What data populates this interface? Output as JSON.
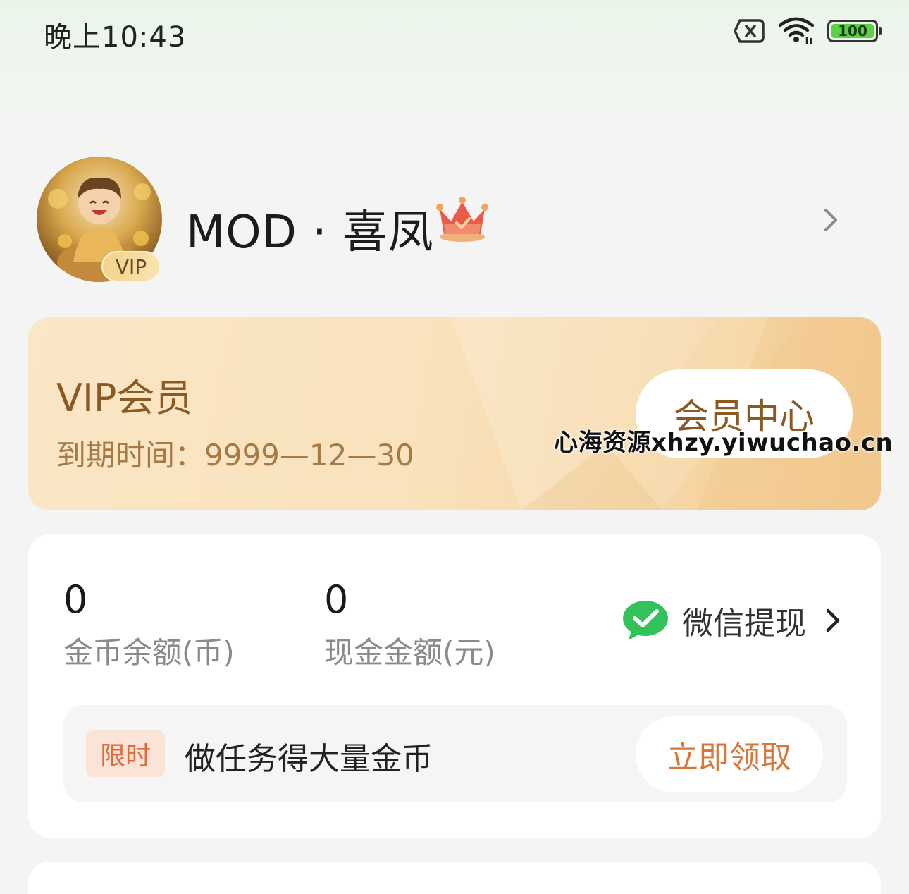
{
  "status_bar": {
    "time": "晚上10:43",
    "battery_level": "100",
    "icons": [
      "sim-off-icon",
      "wifi-icon",
      "battery-icon"
    ]
  },
  "profile": {
    "username": "MOD · 喜凤",
    "vip_badge": "VIP",
    "icons": [
      "avatar",
      "crown-icon",
      "chevron-right-icon"
    ]
  },
  "vip_card": {
    "title": "VIP会员",
    "expiry": "到期时间：9999—12—30",
    "member_center_label": "会员中心",
    "colors": {
      "text": "#8a5a22",
      "background": "#f9e2bd"
    }
  },
  "watermark": "心海资源xhzy.yiwuchao.cn",
  "wallet": {
    "coins": {
      "value": "0",
      "label": "金币余额(币)"
    },
    "cash": {
      "value": "0",
      "label": "现金金额(元)"
    },
    "withdraw_label": "微信提现",
    "withdraw_icon": "wechat-icon",
    "task_banner": {
      "tag": "限时",
      "text": "做任务得大量金币",
      "button_label": "立即领取",
      "colors": {
        "tag": "#e06a3c",
        "button": "#d9773a"
      }
    }
  }
}
